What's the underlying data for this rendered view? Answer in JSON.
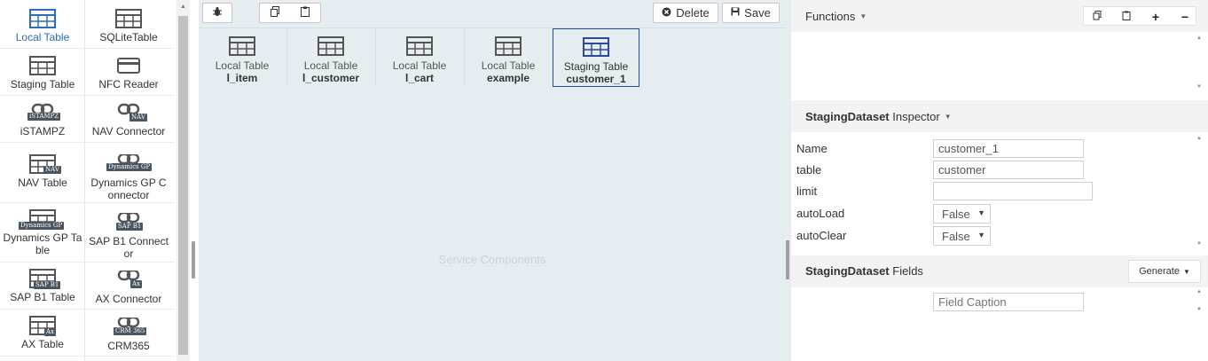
{
  "palette": {
    "items": [
      {
        "label": "Local Table",
        "icon": "table-icon"
      },
      {
        "label": "SQLiteTable",
        "icon": "table-icon"
      },
      {
        "label": "Staging Table",
        "icon": "table-icon"
      },
      {
        "label": "NFC Reader",
        "icon": "card-icon"
      },
      {
        "label": "iSTAMPZ",
        "icon": "link-icon",
        "tag": "iSTAMPZ"
      },
      {
        "label": "NAV Connector",
        "icon": "link-icon",
        "tag": "NAV"
      },
      {
        "label": "NAV Table",
        "icon": "table-icon",
        "tag": "NAV"
      },
      {
        "label": "Dynamics GP C onnector",
        "icon": "link-icon",
        "tag": "Dynamics GP"
      },
      {
        "label": "Dynamics GP Ta ble",
        "icon": "table-icon",
        "tag": "Dynamics GP"
      },
      {
        "label": "SAP B1 Connect or",
        "icon": "link-icon",
        "tag": "SAP B1"
      },
      {
        "label": "SAP B1 Table",
        "icon": "table-icon",
        "tag": "SAP B1"
      },
      {
        "label": "AX Connector",
        "icon": "link-icon",
        "tag": "Ax"
      },
      {
        "label": "AX Table",
        "icon": "table-icon",
        "tag": "Ax"
      },
      {
        "label": "CRM365",
        "icon": "link-icon",
        "tag": "CRM 365"
      }
    ]
  },
  "toolbar": {
    "delete_label": "Delete",
    "save_label": "Save"
  },
  "canvas": {
    "components": [
      {
        "type": "Local Table",
        "name": "l_item"
      },
      {
        "type": "Local Table",
        "name": "l_customer"
      },
      {
        "type": "Local Table",
        "name": "l_cart"
      },
      {
        "type": "Local Table",
        "name": "example"
      },
      {
        "type": "Staging Table",
        "name": "customer_1"
      }
    ],
    "placeholder": "Service Components"
  },
  "functions": {
    "title": "Functions"
  },
  "inspector": {
    "title_bold": "StagingDataset",
    "title_rest": " Inspector",
    "props": [
      {
        "label": "Name",
        "value": "customer_1"
      },
      {
        "label": "table",
        "value": "customer"
      },
      {
        "label": "limit",
        "value": ""
      },
      {
        "label": "autoLoad",
        "value": "False"
      },
      {
        "label": "autoClear",
        "value": "False"
      }
    ]
  },
  "fields": {
    "title_bold": "StagingDataset",
    "title_rest": " Fields",
    "generate_label": "Generate",
    "caption_placeholder": "Field Caption"
  },
  "colors": {
    "accent": "#2a6ebb",
    "selected_border": "#2a4b9b",
    "canvas_bg": "#e6edf0",
    "icon": "#555555"
  }
}
